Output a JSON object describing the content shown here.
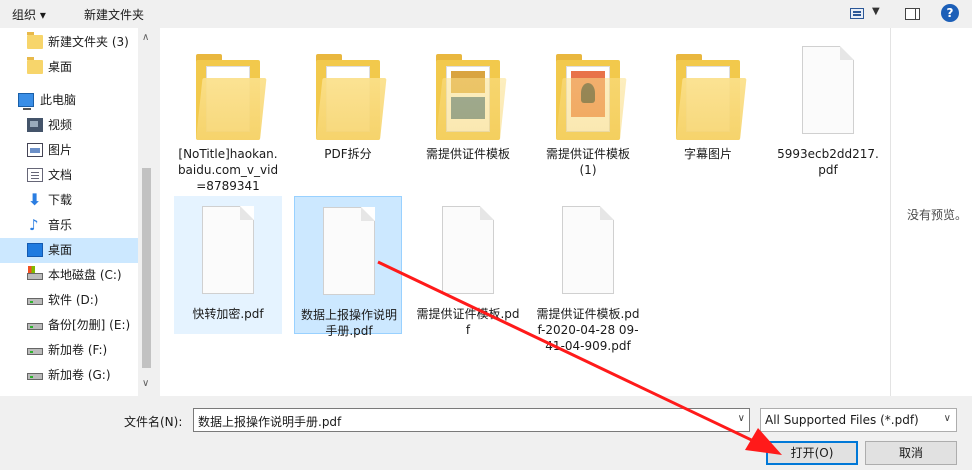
{
  "toolbar": {
    "organize_label": "组织 ▾",
    "new_folder_label": "新建文件夹",
    "help_label": "?"
  },
  "nav": {
    "items": [
      {
        "label": "新建文件夹 (3)",
        "icon": "folder-icon"
      },
      {
        "label": "桌面",
        "icon": "folder-icon"
      },
      {
        "label": "此电脑",
        "icon": "computer-icon"
      },
      {
        "label": "视频",
        "icon": "video-icon"
      },
      {
        "label": "图片",
        "icon": "picture-icon"
      },
      {
        "label": "文档",
        "icon": "document-icon"
      },
      {
        "label": "下载",
        "icon": "download-icon"
      },
      {
        "label": "音乐",
        "icon": "music-icon"
      },
      {
        "label": "桌面",
        "icon": "desktop-icon"
      },
      {
        "label": "本地磁盘 (C:)",
        "icon": "system-drive-icon"
      },
      {
        "label": "软件 (D:)",
        "icon": "drive-icon"
      },
      {
        "label": "备份[勿删] (E:)",
        "icon": "drive-icon"
      },
      {
        "label": "新加卷 (F:)",
        "icon": "drive-icon"
      },
      {
        "label": "新加卷 (G:)",
        "icon": "drive-icon"
      }
    ],
    "selected_index": 8
  },
  "files": [
    {
      "name": "[NoTitle]haokan.baidu.com_v_vid=8789341",
      "type": "folder"
    },
    {
      "name": "PDF拆分",
      "type": "folder"
    },
    {
      "name": "需提供证件模板",
      "type": "folder-with-images"
    },
    {
      "name": "需提供证件模板 (1)",
      "type": "folder-with-poster"
    },
    {
      "name": "字幕图片",
      "type": "folder"
    },
    {
      "name": "5993ecb2dd217.pdf",
      "type": "pdf"
    },
    {
      "name": "快转加密.pdf",
      "type": "pdf",
      "state": "hover"
    },
    {
      "name": "数据上报操作说明手册.pdf",
      "type": "pdf",
      "state": "selected"
    },
    {
      "name": "需提供证件模板.pdf",
      "type": "pdf"
    },
    {
      "name": "需提供证件模板.pdf-2020-04-28 09-41-04-909.pdf",
      "type": "pdf"
    }
  ],
  "preview": {
    "no_preview_text": "没有预览。"
  },
  "bottom": {
    "filename_label": "文件名(N):",
    "filename_value": "数据上报操作说明手册.pdf",
    "filetype_value": "All Supported Files (*.pdf)",
    "open_label": "打开(O)",
    "cancel_label": "取消"
  },
  "colors": {
    "selection": "#cce8ff",
    "accent": "#0078d7",
    "annotation_arrow": "#ff1a1a"
  }
}
